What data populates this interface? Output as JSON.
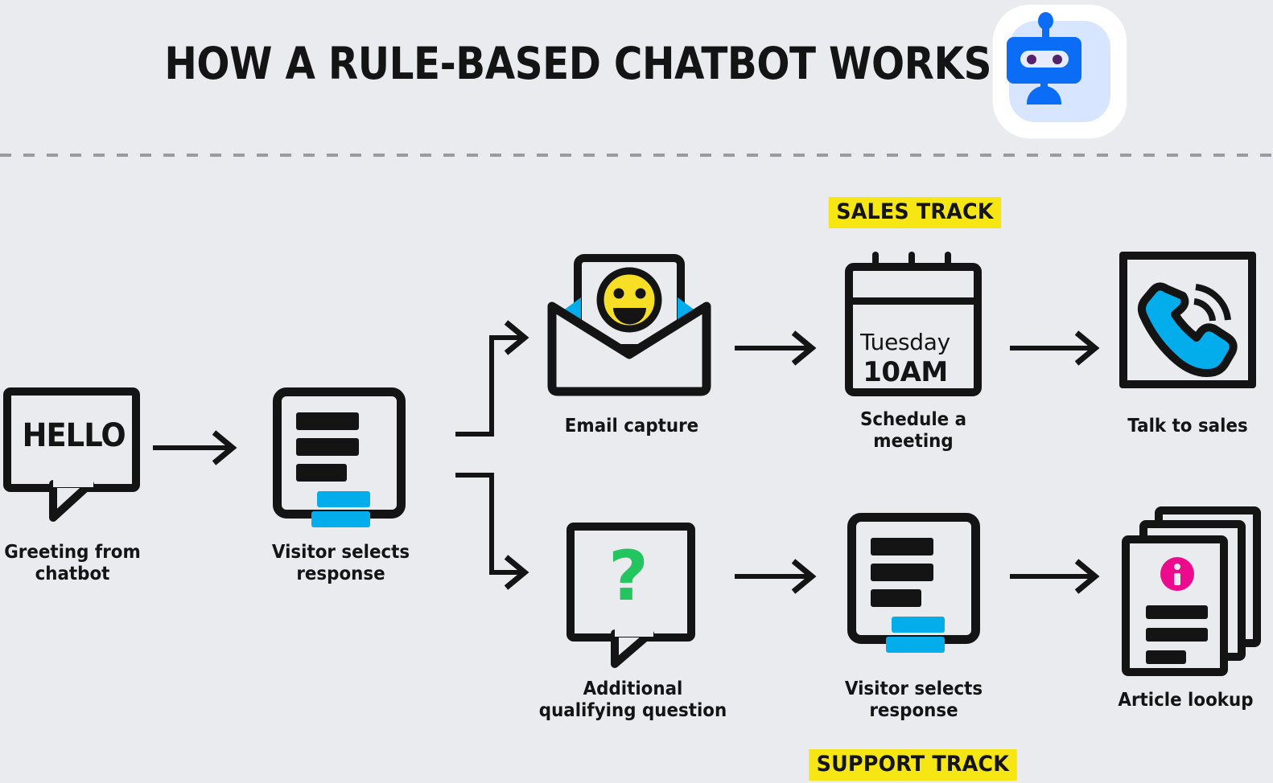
{
  "page": {
    "background_color": "#e9ebef",
    "ink_color": "#141414",
    "accent_cyan": "#03adec",
    "accent_yellow": "#f5e614",
    "accent_green": "#22c55e",
    "accent_magenta": "#ec0b8c",
    "accent_blue": "#0b6cf5",
    "divider_color": "#9a9ba1"
  },
  "header": {
    "title": "HOW A RULE-BASED CHATBOT WORKS",
    "logo_icon": "robot-icon"
  },
  "tracks": {
    "sales": "SALES TRACK",
    "support": "SUPPORT TRACK"
  },
  "chart_data": {
    "type": "diagram",
    "title": "HOW A RULE-BASED CHATBOT WORKS",
    "layout": "left-to-right flowchart with one branch point splitting into two parallel tracks",
    "nodes": [
      {
        "id": "greeting",
        "label": "Greeting from chatbot",
        "icon": "speech-bubble-hello-icon",
        "row": "trunk"
      },
      {
        "id": "select1",
        "label": "Visitor selects response",
        "icon": "chat-card-icon",
        "row": "trunk"
      },
      {
        "id": "email",
        "label": "Email capture",
        "icon": "open-envelope-smiley-icon",
        "row": "sales"
      },
      {
        "id": "schedule",
        "label": "Schedule a meeting",
        "icon": "calendar-icon",
        "row": "sales"
      },
      {
        "id": "sales",
        "label": "Talk to sales",
        "icon": "phone-icon",
        "row": "sales"
      },
      {
        "id": "qualify",
        "label": "Additional qualifying question",
        "icon": "speech-bubble-question-icon",
        "row": "support"
      },
      {
        "id": "select2",
        "label": "Visitor selects response",
        "icon": "chat-card-icon",
        "row": "support"
      },
      {
        "id": "article",
        "label": "Article lookup",
        "icon": "document-stack-info-icon",
        "row": "support"
      }
    ],
    "edges": [
      {
        "from": "greeting",
        "to": "select1",
        "style": "straight-arrow"
      },
      {
        "from": "select1",
        "to": "email",
        "style": "elbow-arrow-up"
      },
      {
        "from": "select1",
        "to": "qualify",
        "style": "elbow-arrow-down"
      },
      {
        "from": "email",
        "to": "schedule",
        "style": "straight-arrow"
      },
      {
        "from": "schedule",
        "to": "sales",
        "style": "straight-arrow"
      },
      {
        "from": "qualify",
        "to": "select2",
        "style": "straight-arrow"
      },
      {
        "from": "select2",
        "to": "article",
        "style": "straight-arrow"
      }
    ]
  },
  "nodes": {
    "greeting": {
      "label_line1": "Greeting from",
      "label_line2": "chatbot",
      "bubble_text": "HELLO"
    },
    "select1": {
      "label_line1": "Visitor selects",
      "label_line2": "response"
    },
    "email": {
      "label": "Email capture"
    },
    "schedule": {
      "label_line1": "Schedule a",
      "label_line2": "meeting",
      "calendar_day": "Tuesday",
      "calendar_time": "10AM"
    },
    "sales": {
      "label": "Talk to sales"
    },
    "qualify": {
      "label_line1": "Additional",
      "label_line2": "qualifying question",
      "bubble_text": "?"
    },
    "select2": {
      "label_line1": "Visitor selects",
      "label_line2": "response"
    },
    "article": {
      "label": "Article lookup"
    }
  }
}
